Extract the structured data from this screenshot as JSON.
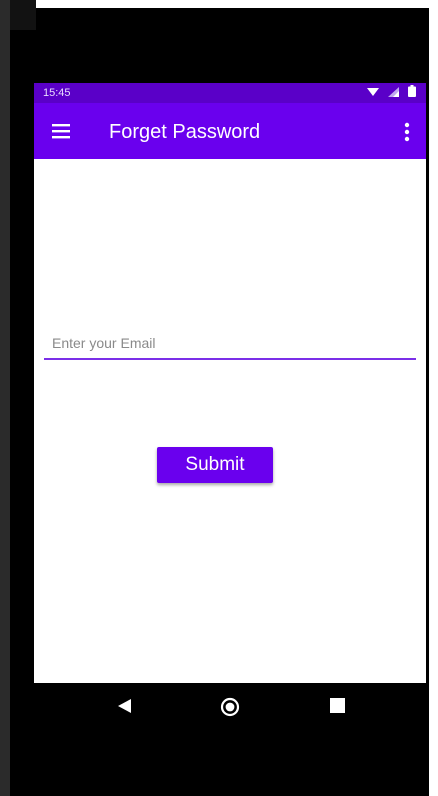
{
  "status_bar": {
    "time": "15:45",
    "icons": [
      "wifi-icon",
      "signal-icon",
      "battery-icon"
    ]
  },
  "app_bar": {
    "title": "Forget Password",
    "menu_icon": "hamburger-menu-icon",
    "overflow_icon": "more-vert-icon"
  },
  "form": {
    "email_placeholder": "Enter your Email",
    "email_value": "",
    "submit_label": "Submit"
  },
  "nav_bar": {
    "buttons": [
      "back-icon",
      "home-icon",
      "recents-icon"
    ]
  },
  "colors": {
    "primary": "#6a00ee",
    "status_bar": "#5a00c8",
    "accent_underline": "#7b2fe8"
  }
}
